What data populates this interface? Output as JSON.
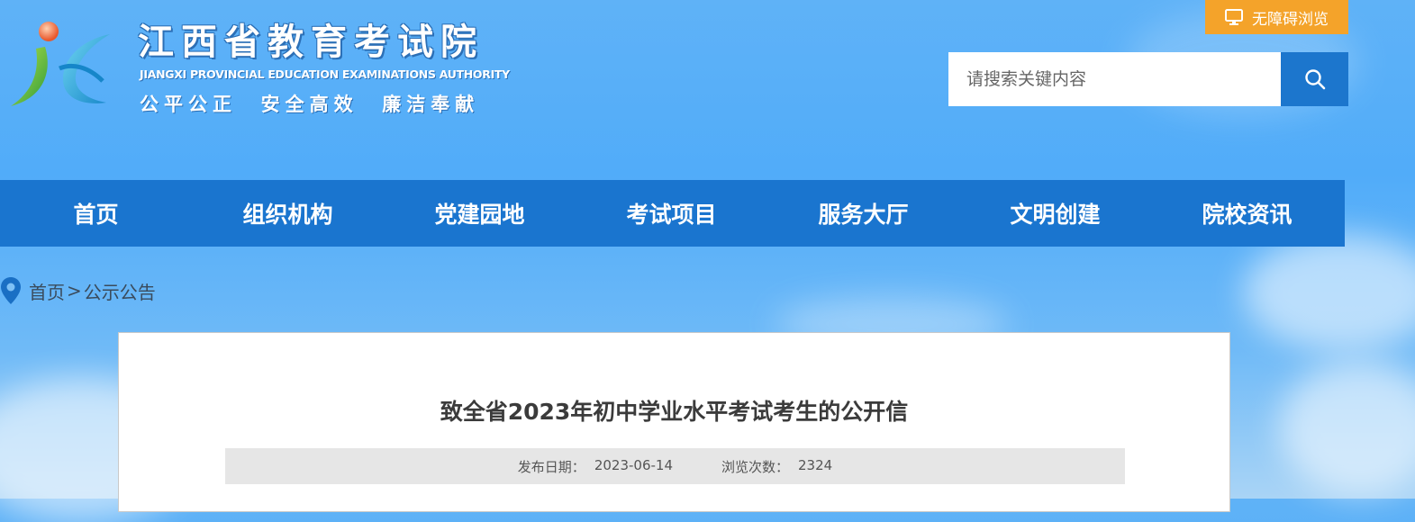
{
  "header": {
    "title": "江西省教育考试院",
    "subtitle": "JIANGXI PROVINCIAL EDUCATION EXAMINATIONS AUTHORITY",
    "slogan": "公平公正  安全高效  廉洁奉献"
  },
  "accessibility": {
    "label": "无障碍浏览",
    "icon": "monitor-icon"
  },
  "search": {
    "placeholder": "请搜索关键内容",
    "icon": "search-icon"
  },
  "nav": {
    "items": [
      {
        "label": "首页"
      },
      {
        "label": "组织机构"
      },
      {
        "label": "党建园地"
      },
      {
        "label": "考试项目"
      },
      {
        "label": "服务大厅"
      },
      {
        "label": "文明创建"
      },
      {
        "label": "院校资讯"
      }
    ]
  },
  "breadcrumb": {
    "home": "首页",
    "separator": ">",
    "current": "公示公告",
    "icon": "location-pin-icon"
  },
  "article": {
    "title": "致全省2023年初中学业水平考试考生的公开信",
    "date_label": "发布日期：",
    "date": "2023-06-14",
    "views_label": "浏览次数：",
    "views": "2324"
  },
  "colors": {
    "nav_bg": "#1a75cf",
    "accent_orange": "#f4a32a",
    "search_btn": "#1c76cd"
  }
}
